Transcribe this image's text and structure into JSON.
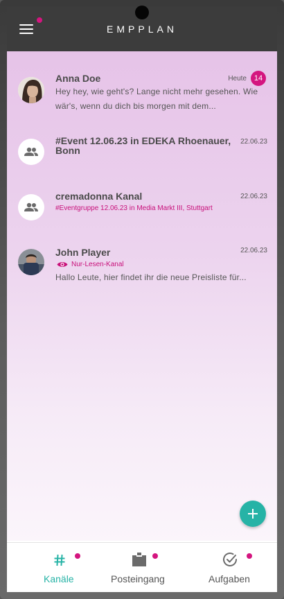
{
  "app": {
    "brand": "EMPPLAN"
  },
  "colors": {
    "accent": "#d4157f",
    "teal": "#26b3a6",
    "appbar": "#3c3c3c"
  },
  "conversations": [
    {
      "title": "Anna Doe",
      "date": "Heute",
      "unread": "14",
      "preview": "Hey hey, wie geht's? Lange nicht mehr gesehen. Wie wär's, wenn du dich bis morgen mit dem...",
      "avatar": "photo-woman"
    },
    {
      "title": "#Event 12.06.23 in EDEKA Rhoenauer, Bonn",
      "date": "22.06.23",
      "avatar": "group-icon"
    },
    {
      "title": "cremadonna Kanal",
      "date": "22.06.23",
      "subtitle": "#Eventgruppe 12.06.23 in Media Markt III, Stuttgart",
      "avatar": "group-icon"
    },
    {
      "title": "John Player",
      "date": "22.06.23",
      "readonly_label": "Nur-Lesen-Kanal",
      "preview": "Hallo Leute, hier findet ihr die neue Preisliste für...",
      "avatar": "photo-man"
    }
  ],
  "nav": [
    {
      "label": "Kanäle",
      "icon": "hash-icon",
      "active": true
    },
    {
      "label": "Posteingang",
      "icon": "inbox-icon",
      "active": false
    },
    {
      "label": "Aufgaben",
      "icon": "check-circle-icon",
      "active": false
    }
  ]
}
